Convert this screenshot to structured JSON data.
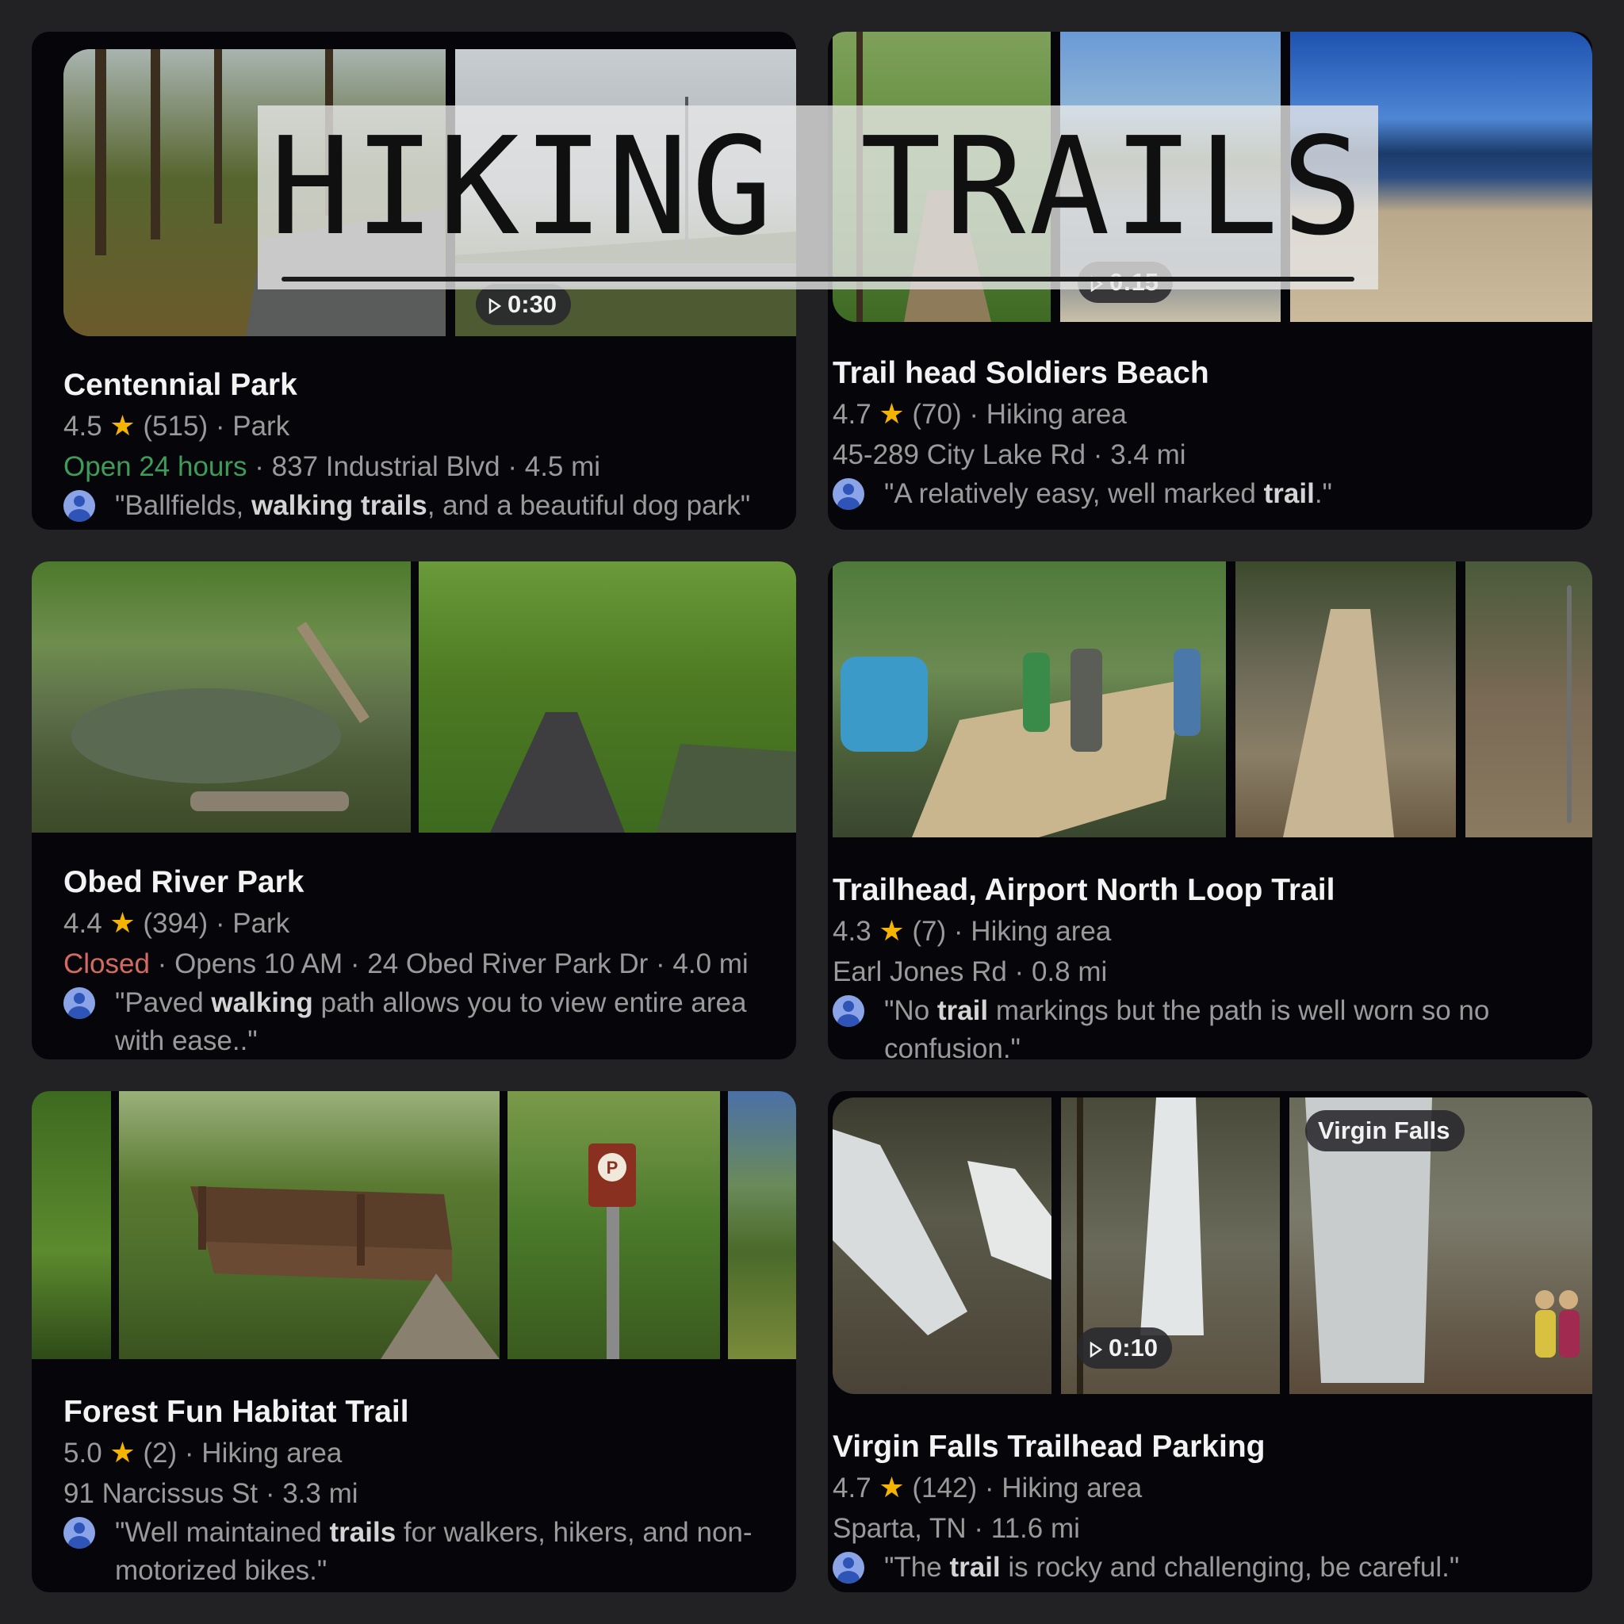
{
  "banner": {
    "title": "HIKING TRAILS"
  },
  "cards": [
    {
      "name": "Centennial Park",
      "rating": "4.5",
      "reviews": "(515)",
      "category": "Park",
      "status": "Open 24 hours",
      "address": "837 Industrial Blvd",
      "distance": "4.5 mi",
      "review_pre": "\"Ballfields, ",
      "review_bold": "walking trails",
      "review_post": ", and a beautiful dog park\"",
      "video_duration": "0:30"
    },
    {
      "name": "Trail head Soldiers Beach",
      "rating": "4.7",
      "reviews": "(70)",
      "category": "Hiking area",
      "address": "45-289 City Lake Rd",
      "distance": "3.4 mi",
      "review_pre": "\"A relatively easy, well marked ",
      "review_bold": "trail",
      "review_post": ".\"",
      "video_duration": "0:15"
    },
    {
      "name": "Obed River Park",
      "rating": "4.4",
      "reviews": "(394)",
      "category": "Park",
      "status": "Closed",
      "opens": "Opens 10 AM",
      "address": "24 Obed River Park Dr",
      "distance": "4.0 mi",
      "review_pre": "\"Paved ",
      "review_bold": "walking",
      "review_post": " path allows you to view entire area with ease..\""
    },
    {
      "name": "Trailhead, Airport North Loop Trail",
      "rating": "4.3",
      "reviews": "(7)",
      "category": "Hiking area",
      "address": "Earl Jones Rd",
      "distance": "0.8 mi",
      "review_pre": "\"No ",
      "review_bold": "trail",
      "review_post": " markings but the path is well worn so no confusion.\""
    },
    {
      "name": "Forest Fun Habitat Trail",
      "rating": "5.0",
      "reviews": "(2)",
      "category": "Hiking area",
      "address": "91 Narcissus St",
      "distance": "3.3 mi",
      "review_pre": "\"Well maintained ",
      "review_bold": "trails",
      "review_post": " for walkers, hikers, and non-motorized bikes.\""
    },
    {
      "name": "Virgin Falls Trailhead Parking",
      "rating": "4.7",
      "reviews": "(142)",
      "category": "Hiking area",
      "address": "Sparta, TN",
      "distance": "11.6 mi",
      "review_pre": "\"The ",
      "review_bold": "trail",
      "review_post": " is rocky and challenging, be careful.\"",
      "video_duration": "0:10",
      "photo_label": "Virgin Falls"
    }
  ],
  "separator": " · ",
  "colors": {
    "background": "#222224",
    "card": "#06060a",
    "star": "#f5b400",
    "open": "#3f9b5a",
    "closed": "#d46a62"
  },
  "icons": [
    "star-icon",
    "play-icon",
    "avatar-icon"
  ]
}
